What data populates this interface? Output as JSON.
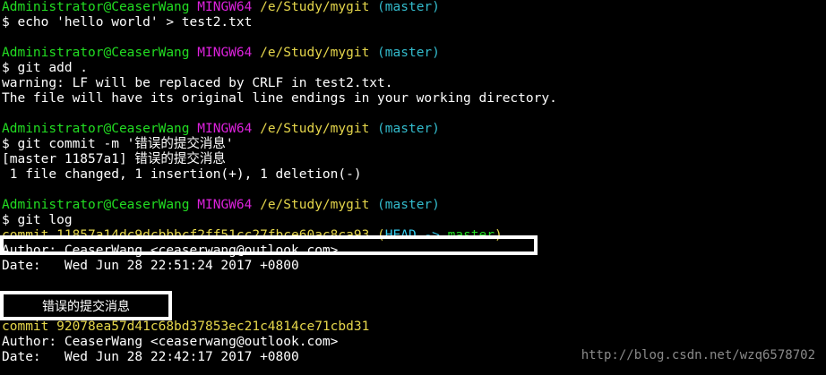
{
  "prompt": {
    "user": "Administrator@CeaserWang",
    "host": "MINGW64",
    "path": "/e/Study/mygit",
    "branch": "(master)"
  },
  "blocks": [
    {
      "command": "$ echo 'hello world' > test2.txt",
      "output": []
    },
    {
      "command": "$ git add .",
      "output": [
        "warning: LF will be replaced by CRLF in test2.txt.",
        "The file will have its original line endings in your working directory."
      ]
    },
    {
      "command": "$ git commit -m '错误的提交消息'",
      "output": [
        "[master 11857a1] 错误的提交消息",
        " 1 file changed, 1 insertion(+), 1 deletion(-)"
      ]
    },
    {
      "command": "$ git log",
      "output": []
    }
  ],
  "log": {
    "commit1": {
      "prefix": "commit 11857a14dc9dcbbbcf2ff51cc27fbce60ac8ca93 ",
      "ref_open": "(",
      "head": "HEAD -> ",
      "branch": "master",
      "ref_close": ")",
      "author": "Author: CeaserWang <ceaserwang@outlook.com>",
      "date": "Date:   Wed Jun 28 22:51:24 2017 +0800",
      "message": "错误的提交消息"
    },
    "commit2": {
      "prefix": "commit 92078ea57d41c68bd37853ec21c4814ce71cbd31",
      "author": "Author: CeaserWang <ceaserwang@outlook.com>",
      "date": "Date:   Wed Jun 28 22:42:17 2017 +0800"
    }
  },
  "watermark": "http://blog.csdn.net/wzq6578702"
}
